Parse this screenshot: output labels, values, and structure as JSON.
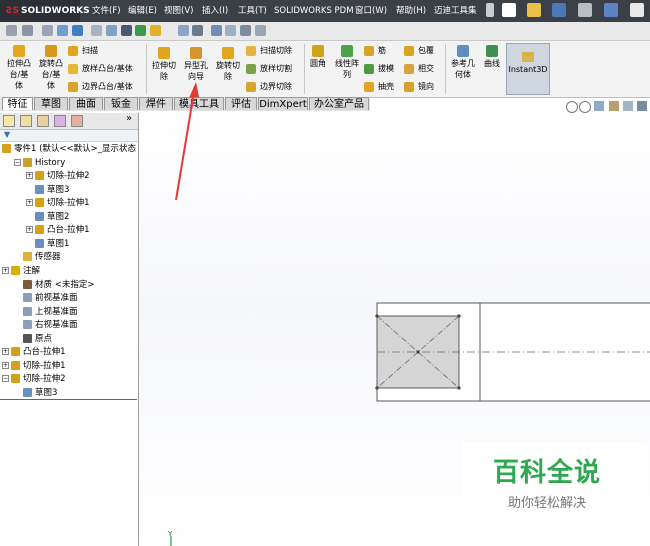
{
  "app": {
    "logo_text": "SOLIDWORKS",
    "menus": [
      "文件(F)",
      "编辑(E)",
      "视图(V)",
      "插入(I)",
      "工具(T)",
      "SOLIDWORKS PDM",
      "窗口(W)",
      "帮助(H)",
      "迈迪工具集"
    ]
  },
  "ribbon": {
    "col1": [
      "拉伸凸",
      "台/基",
      "体"
    ],
    "col2": [
      "旋转凸",
      "台/基",
      "体"
    ],
    "sweep": "扫描",
    "loft": "放样凸台/基体",
    "boundary": "边界凸台/基体",
    "cut_extrude": [
      "拉伸切",
      "除"
    ],
    "hole_wizard": [
      "异型孔",
      "向导"
    ],
    "cut_revolve": [
      "旋转切",
      "除"
    ],
    "cut_sweep": "扫描切除",
    "cut_loft": "放样切割",
    "cut_boundary": "边界切除",
    "fillet": "圆角",
    "linear_pattern": [
      "线性阵",
      "列"
    ],
    "rib": "筋",
    "draft": "拔模",
    "shell": "抽壳",
    "wrap": "包覆",
    "intersect": "相交",
    "mirror": "镜向",
    "ref_geom": [
      "参考几",
      "何体"
    ],
    "curves": "曲线",
    "instant3d": "Instant3D"
  },
  "tabs": [
    "特征",
    "草图",
    "曲面",
    "钣金",
    "焊件",
    "模具工具",
    "评估",
    "DimXpert",
    "办公室产品"
  ],
  "tree": {
    "root": "零件1 (默认<<默认>_显示状态",
    "items": [
      {
        "label": "History",
        "indent": 1,
        "expander": "−",
        "icon_color": "#c9a227"
      },
      {
        "label": "切除-拉伸2",
        "indent": 2,
        "expander": "+",
        "icon_color": "#d4a017"
      },
      {
        "label": "草图3",
        "indent": 2,
        "expander": "",
        "icon_color": "#6a8fbf"
      },
      {
        "label": "切除-拉伸1",
        "indent": 2,
        "expander": "+",
        "icon_color": "#d4a017"
      },
      {
        "label": "草图2",
        "indent": 2,
        "expander": "",
        "icon_color": "#6a8fbf"
      },
      {
        "label": "凸台-拉伸1",
        "indent": 2,
        "expander": "+",
        "icon_color": "#d4a017"
      },
      {
        "label": "草图1",
        "indent": 2,
        "expander": "",
        "icon_color": "#6a8fbf"
      },
      {
        "label": "传感器",
        "indent": 1,
        "expander": "",
        "icon_color": "#e0b040"
      },
      {
        "label": "注解",
        "indent": 0,
        "expander": "+",
        "icon_color": "#d9b000"
      },
      {
        "label": "材质 <未指定>",
        "indent": 1,
        "expander": "",
        "icon_color": "#7b5a3a"
      },
      {
        "label": "前视基准面",
        "indent": 1,
        "expander": "",
        "icon_color": "#8aa0b8"
      },
      {
        "label": "上视基准面",
        "indent": 1,
        "expander": "",
        "icon_color": "#8aa0b8"
      },
      {
        "label": "右视基准面",
        "indent": 1,
        "expander": "",
        "icon_color": "#8aa0b8"
      },
      {
        "label": "原点",
        "indent": 1,
        "expander": "",
        "icon_color": "#555555"
      },
      {
        "label": "凸台-拉伸1",
        "indent": 0,
        "expander": "+",
        "icon_color": "#d4a017"
      },
      {
        "label": "切除-拉伸1",
        "indent": 0,
        "expander": "+",
        "icon_color": "#d4a017"
      },
      {
        "label": "切除-拉伸2",
        "indent": 0,
        "expander": "−",
        "icon_color": "#d4a017"
      },
      {
        "label": "草图3",
        "indent": 1,
        "expander": "",
        "icon_color": "#6a8fbf"
      }
    ]
  },
  "watermark": {
    "title": "百科全说",
    "subtitle": "助你轻松解决"
  },
  "canvas": {
    "axis_label": "Y"
  },
  "colors": {
    "menubar": "#3b3f46",
    "accent_red": "#e53935",
    "watermark_green": "#2fa84f",
    "selection_line": "#4a7fc1"
  }
}
